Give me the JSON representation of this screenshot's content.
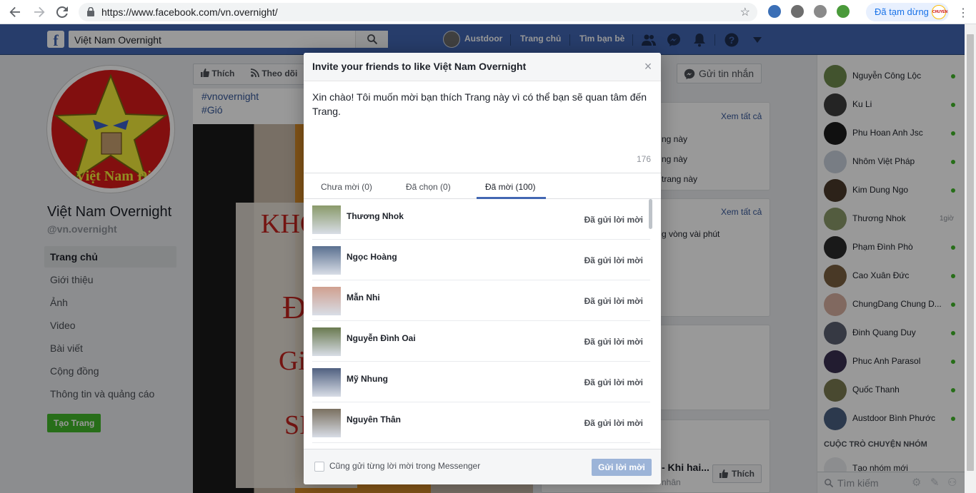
{
  "browser": {
    "url": "https://www.facebook.com/vn.overnight/",
    "profile_status": "Đã tạm dừng",
    "profile_badge": "CHUYỂN"
  },
  "fbbar": {
    "search_value": "Việt Nam Overnight",
    "user_name": "Austdoor",
    "home_label": "Trang chủ",
    "find_friends_label": "Tìm bạn bè"
  },
  "page": {
    "name": "Việt Nam Overnight",
    "handle": "@vn.overnight",
    "logo_text": "Việt Nam Đi",
    "nav": [
      {
        "label": "Trang chủ"
      },
      {
        "label": "Giới thiệu"
      },
      {
        "label": "Ảnh"
      },
      {
        "label": "Video"
      },
      {
        "label": "Bài viết"
      },
      {
        "label": "Cộng đồng"
      },
      {
        "label": "Thông tin và quảng cáo"
      }
    ],
    "create_page_label": "Tạo Trang",
    "like_label": "Thích",
    "follow_label": "Theo dõi",
    "send_message_label": "Gửi tin nhắn",
    "hashtags": [
      "#vnovernight",
      "#Gió"
    ],
    "photo_text": [
      "KHÔ",
      "Đ",
      "Giá",
      "SI"
    ]
  },
  "right_cards": {
    "see_all_1": "Xem tất cả",
    "lines_1": [
      "ng này",
      "ng này",
      "trang này"
    ],
    "see_all_2": "Xem tất cả",
    "line_2": "g vòng vài phút",
    "bottom_title": "- Khi hai...",
    "bottom_sub": "nhân",
    "bottom_like": "Thích"
  },
  "chat": {
    "contacts": [
      {
        "name": "Nguyễn Công Lộc",
        "color": "#6f8a4e",
        "online": true
      },
      {
        "name": "Ku Li",
        "color": "#3c3c3c",
        "online": true
      },
      {
        "name": "Phu Hoan Anh Jsc",
        "color": "#1b1b1b",
        "online": true
      },
      {
        "name": "Nhôm Việt Pháp",
        "color": "#c9d0dc",
        "online": true
      },
      {
        "name": "Kim Dung Ngo",
        "color": "#4a3a2a",
        "online": true
      },
      {
        "name": "Thương Nhok",
        "color": "#8a9a6a",
        "online": false,
        "time": "1giờ"
      },
      {
        "name": "Phạm Đình Phò",
        "color": "#2a2a2a",
        "online": true
      },
      {
        "name": "Cao Xuân Đức",
        "color": "#7a6040",
        "online": true
      },
      {
        "name": "ChungDang Chung D...",
        "color": "#d8b0a0",
        "online": true
      },
      {
        "name": "Đinh Quang Duy",
        "color": "#5a6070",
        "online": true
      },
      {
        "name": "Phuc Anh Parasol",
        "color": "#3a3050",
        "online": true
      },
      {
        "name": "Quốc Thanh",
        "color": "#7a7a50",
        "online": true
      },
      {
        "name": "Austdoor Bình Phước",
        "color": "#4a6080",
        "online": true
      }
    ],
    "group_header": "CUỘC TRÒ CHUYỆN NHÓM",
    "create_group": "Tạo nhóm mới",
    "search_placeholder": "Tìm kiếm"
  },
  "modal": {
    "title": "Invite your friends to like Việt Nam Overnight",
    "message": "Xin chào! Tôi muốn mời bạn thích Trang này vì có thể bạn sẽ quan tâm đến Trang.",
    "char_count": "176",
    "tabs": [
      {
        "label": "Chưa mời (0)"
      },
      {
        "label": "Đã chọn (0)"
      },
      {
        "label": "Đã mời (100)"
      }
    ],
    "friends": [
      {
        "name": "Thương Nhok",
        "status": "Đã gửi lời mời",
        "color": "#8a9a6a"
      },
      {
        "name": "Ngọc Hoàng",
        "status": "Đã gửi lời mời",
        "color": "#5a7090"
      },
      {
        "name": "Mẫn Nhi",
        "status": "Đã gửi lời mời",
        "color": "#d0a090"
      },
      {
        "name": "Nguyễn Đình Oai",
        "status": "Đã gửi lời mời",
        "color": "#6a7a50"
      },
      {
        "name": "Mỹ Nhung",
        "status": "Đã gửi lời mời",
        "color": "#506080"
      },
      {
        "name": "Nguyên Thân",
        "status": "Đã gửi lời mời",
        "color": "#7a7060"
      }
    ],
    "checkbox_label": "Cũng gửi từng lời mời trong Messenger",
    "send_label": "Gửi lời mời",
    "close_glyph": "×"
  }
}
